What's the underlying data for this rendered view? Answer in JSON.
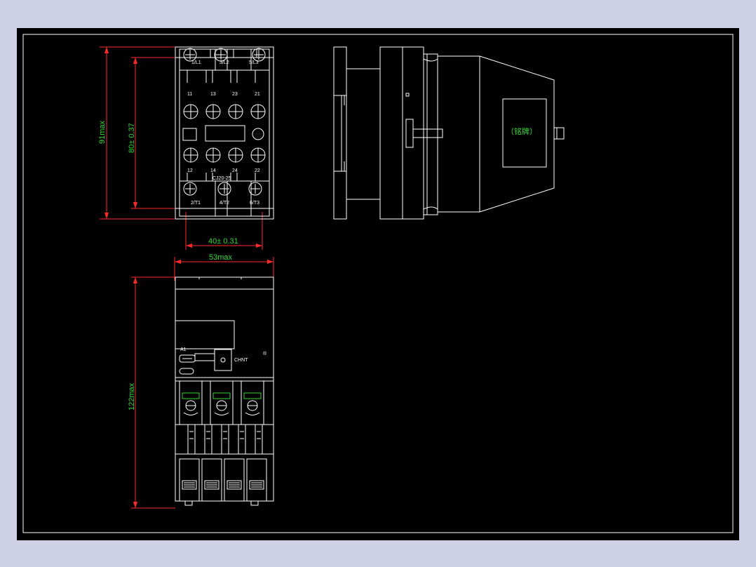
{
  "dimensions": {
    "height_front": "91max",
    "height_inner": "80± 0.37",
    "width_mount": "40± 0.31",
    "width_total": "53max",
    "height_side": "122max"
  },
  "front_view": {
    "top_terminals": [
      "1/L1",
      "3/L2",
      "5/L3"
    ],
    "aux_top_numbers": [
      "11",
      "13",
      "23",
      "21"
    ],
    "aux_bottom_numbers": [
      "12",
      "14",
      "24",
      "22"
    ],
    "model": "CJ20-25",
    "bottom_terminals": [
      "2/T1",
      "4/T2",
      "6/T3"
    ]
  },
  "side_view": {
    "nameplate": "（铭牌）"
  },
  "top_view": {
    "coil_terminal": "A1",
    "brand": "CHNT",
    "brand_mark": "®"
  },
  "colors": {
    "background": "#cfd2e6",
    "sheet": "#000000",
    "outline": "#ffffff",
    "dimension_line": "#ff2a2a",
    "dimension_text": "#2bd92b"
  }
}
